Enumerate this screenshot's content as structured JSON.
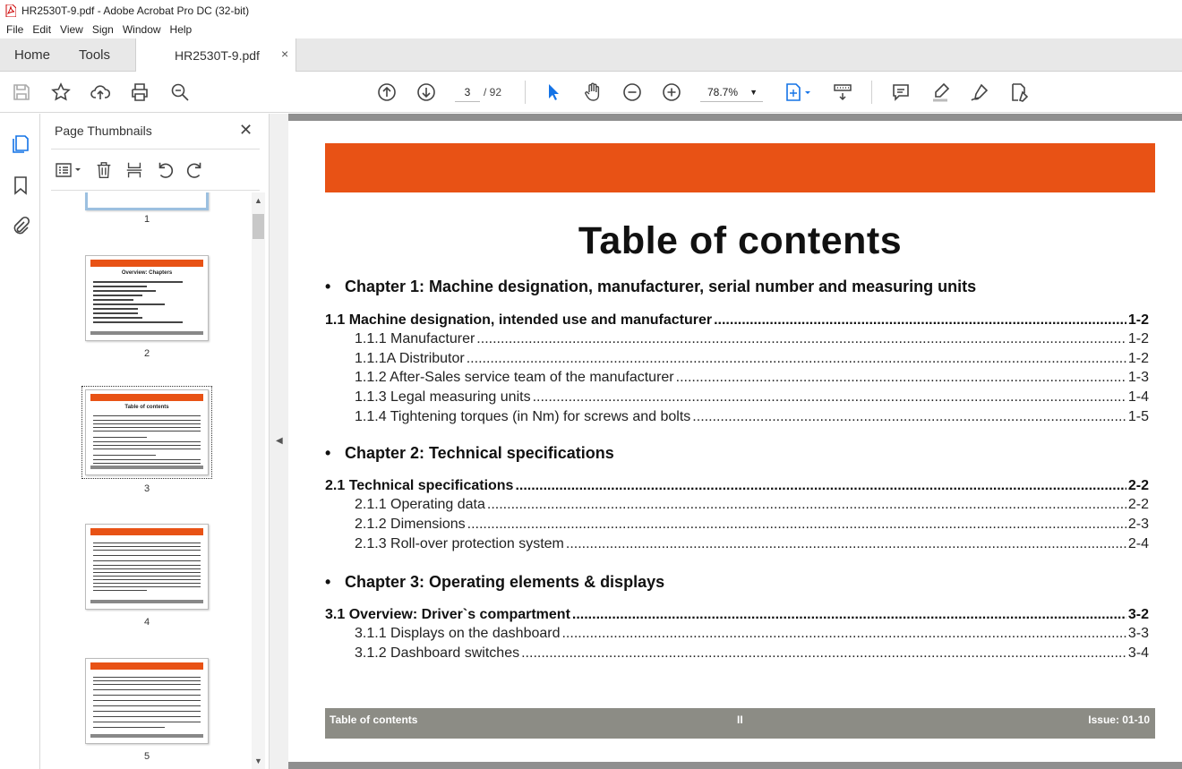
{
  "window": {
    "title": "HR2530T-9.pdf - Adobe Acrobat Pro DC (32-bit)"
  },
  "menu": [
    "File",
    "Edit",
    "View",
    "Sign",
    "Window",
    "Help"
  ],
  "tabs": {
    "home": "Home",
    "tools": "Tools",
    "doc": "HR2530T-9.pdf",
    "close": "×"
  },
  "toolbar": {
    "page_current": "3",
    "page_total": "/ 92",
    "zoom": "78.7%",
    "zoom_caret": "▼"
  },
  "thumb_panel": {
    "title": "Page Thumbnails",
    "close": "✕",
    "thumbs": [
      {
        "num": "1",
        "title": ""
      },
      {
        "num": "2",
        "title": "Overview: Chapters"
      },
      {
        "num": "3",
        "title": "Table of contents"
      },
      {
        "num": "4",
        "title": ""
      },
      {
        "num": "5",
        "title": ""
      }
    ],
    "up": "▲",
    "down": "▼"
  },
  "splitter": {
    "arrow": "◀"
  },
  "document": {
    "title": "Table of contents",
    "bullet": "•",
    "chapters": [
      {
        "heading": "Chapter 1: Machine designation, manufacturer, serial number and measuring units",
        "entries": [
          {
            "type": "main",
            "label": "1.1 Machine designation, intended use and manufacturer",
            "page": "1-2"
          },
          {
            "type": "sub",
            "label": "1.1.1 Manufacturer",
            "page": "1-2"
          },
          {
            "type": "sub",
            "label": "1.1.1A Distributor",
            "page": "1-2"
          },
          {
            "type": "sub",
            "label": "1.1.2 After-Sales service team of the manufacturer",
            "page": "1-3"
          },
          {
            "type": "sub",
            "label": "1.1.3 Legal measuring units",
            "page": "1-4"
          },
          {
            "type": "sub",
            "label": "1.1.4 Tightening torques (in Nm) for screws and bolts",
            "page": "1-5"
          }
        ]
      },
      {
        "heading": "Chapter 2: Technical specifications",
        "entries": [
          {
            "type": "main",
            "label": "2.1 Technical specifications",
            "page": "2-2"
          },
          {
            "type": "sub",
            "label": "2.1.1 Operating data",
            "page": "2-2"
          },
          {
            "type": "sub",
            "label": "2.1.2 Dimensions",
            "page": "2-3"
          },
          {
            "type": "sub",
            "label": "2.1.3 Roll-over protection system",
            "page": "2-4"
          }
        ]
      },
      {
        "heading": "Chapter 3: Operating elements & displays",
        "entries": [
          {
            "type": "main",
            "label": "3.1 Overview: Driver`s compartment",
            "page": "3-2"
          },
          {
            "type": "sub",
            "label": "3.1.1 Displays on the dashboard",
            "page": "3-3"
          },
          {
            "type": "sub",
            "label": "3.1.2 Dashboard switches",
            "page": "3-4"
          }
        ]
      }
    ],
    "footer": {
      "left": "Table of contents",
      "center": "II",
      "right": "Issue: 01-10"
    }
  },
  "colors": {
    "accent_orange": "#e85215",
    "footer_gray": "#8c8c85",
    "select_blue": "#1473e6"
  }
}
